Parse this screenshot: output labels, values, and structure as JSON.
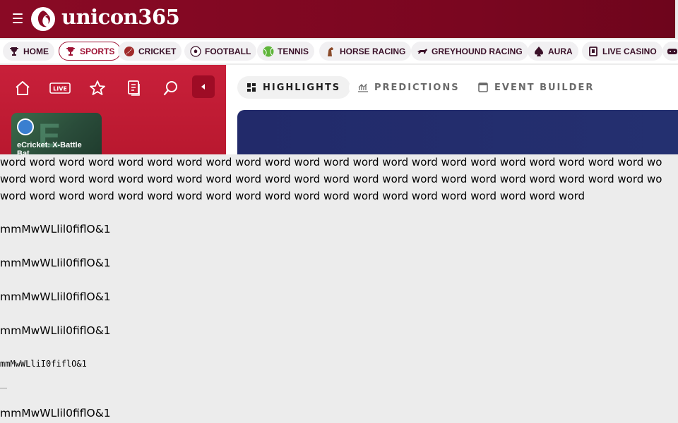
{
  "header": {
    "brand": "unicon365"
  },
  "nav": {
    "items": [
      {
        "label": "HOME",
        "icon": "trophy-icon"
      },
      {
        "label": "SPORTS",
        "icon": "trophy-icon",
        "active": true
      },
      {
        "label": "CRICKET",
        "icon": "cricket-ball-icon"
      },
      {
        "label": "FOOTBALL",
        "icon": "football-icon"
      },
      {
        "label": "TENNIS",
        "icon": "tennis-ball-icon"
      },
      {
        "label": "HORSE RACING",
        "icon": "horse-icon"
      },
      {
        "label": "GREYHOUND RACING",
        "icon": "greyhound-icon"
      },
      {
        "label": "AURA",
        "icon": "spade-icon"
      },
      {
        "label": "LIVE CASINO",
        "icon": "cards-icon"
      }
    ]
  },
  "side_panel": {
    "live_label": "LIVE",
    "card_title": "eCricket: X-Battle Bat..."
  },
  "tabs": [
    {
      "label": "HIGHLIGHTS",
      "icon": "grid-icon",
      "active": true
    },
    {
      "label": "PREDICTIONS",
      "icon": "chart-icon"
    },
    {
      "label": "EVENT BUILDER",
      "icon": "calendar-icon"
    }
  ],
  "test_text": {
    "line1": "word word word word word word word word word word word word word word word word word word word word word word wo",
    "line2": "word word word word word word word word word word word word word word word word word word word word word word wo",
    "line3": "word word word word word word word word word word word word word word word word word word word word",
    "sample": "mmMwWLlil0fiflO&1",
    "sample_mono": "mmMwWLliI0fiflO&1"
  },
  "colors": {
    "brand": "#8a0a25",
    "accent": "#9e1234",
    "panel_red": "#c8203a",
    "banner_navy": "#222a6a"
  }
}
